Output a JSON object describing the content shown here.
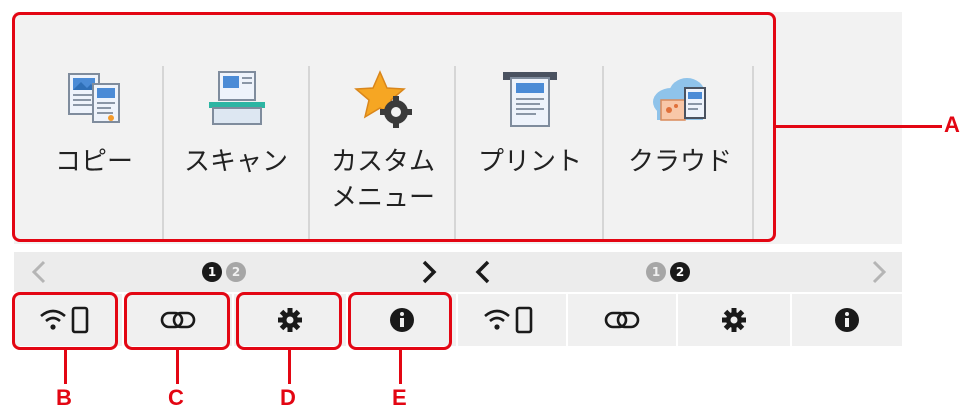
{
  "menu": {
    "items": [
      {
        "label": "コピー",
        "icon": "copy-icon"
      },
      {
        "label": "スキャン",
        "icon": "scan-icon"
      },
      {
        "label": "カスタム\nメニュー",
        "icon": "custom-menu-icon"
      },
      {
        "label": "プリント",
        "icon": "print-icon"
      },
      {
        "label": "クラウド",
        "icon": "cloud-icon"
      }
    ]
  },
  "pager": {
    "left": {
      "dots": [
        "1",
        "2"
      ],
      "active": 1
    },
    "right": {
      "dots": [
        "1",
        "2"
      ],
      "active": 2
    }
  },
  "bottom_bar": {
    "buttons": [
      {
        "icon": "wireless-connect-icon"
      },
      {
        "icon": "network-icon"
      },
      {
        "icon": "setup-gear-icon"
      },
      {
        "icon": "info-icon"
      },
      {
        "icon": "wireless-connect-icon"
      },
      {
        "icon": "network-icon"
      },
      {
        "icon": "setup-gear-icon"
      },
      {
        "icon": "info-icon"
      }
    ]
  },
  "callouts": {
    "a": "A",
    "b": "B",
    "c": "C",
    "d": "D",
    "e": "E"
  },
  "colors": {
    "callout": "#e30613",
    "menu_bg": "#f2f2f2",
    "bar_bg": "#f0f0f0",
    "active_dot": "#1a1a1a"
  }
}
